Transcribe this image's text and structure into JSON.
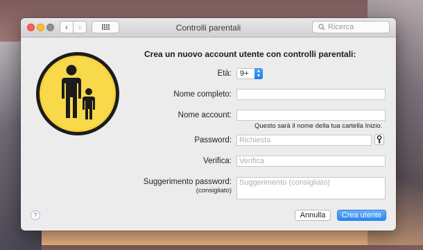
{
  "window": {
    "title": "Controlli parentali",
    "search_placeholder": "Ricerca"
  },
  "form": {
    "heading": "Crea un nuovo account utente con controlli parentali:",
    "age_label": "Età:",
    "age_value": "9+",
    "fullname_label": "Nome completo:",
    "fullname_value": "",
    "account_label": "Nome account:",
    "account_value": "",
    "account_hint": "Questo sarà il nome della tua cartella Inizio.",
    "password_label": "Password:",
    "password_placeholder": "Richiesta",
    "verify_label": "Verifica:",
    "verify_placeholder": "Verifica",
    "hint_label": "Suggerimento password:",
    "hint_label_sub": "(consigliato)",
    "hint_placeholder": "Suggerimento (consigliato)"
  },
  "buttons": {
    "cancel": "Annulla",
    "create": "Crea utente",
    "help": "?"
  },
  "colors": {
    "accent": "#2a86ef",
    "icon_yellow": "#f5d23a"
  }
}
